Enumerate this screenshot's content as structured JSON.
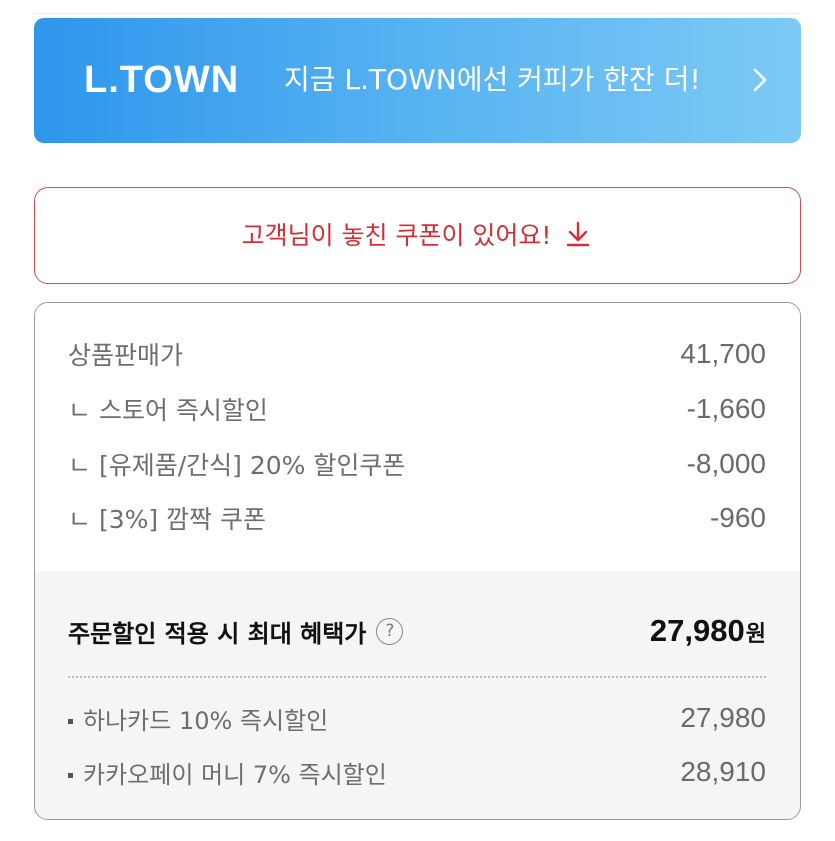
{
  "banner": {
    "logo": "L.TOWN",
    "text": "지금 L.TOWN에선 커피가 한잔 더!",
    "chevron_icon": "chevron-right-icon"
  },
  "coupon_alert": {
    "label": "고객님이 놓친 쿠폰이 있어요!",
    "icon": "download-icon",
    "color": "#d42e37"
  },
  "price_breakdown": {
    "rows": [
      {
        "label": "상품판매가",
        "amount": "41,700"
      },
      {
        "label": "ㄴ 스토어 즉시할인",
        "amount": "-1,660"
      },
      {
        "label": "ㄴ [유제품/간식] 20% 할인쿠폰",
        "amount": "-8,000"
      },
      {
        "label": "ㄴ [3%] 깜짝 쿠폰",
        "amount": "-960"
      }
    ],
    "best_price": {
      "label": "주문할인 적용 시 최대 혜택가",
      "help_icon": "?",
      "amount": "27,980",
      "unit": "원"
    },
    "card_discounts": [
      {
        "label": "하나카드 10% 즉시할인",
        "amount": "27,980"
      },
      {
        "label": "카카오페이 머니 7% 즉시할인",
        "amount": "28,910"
      }
    ]
  },
  "colors": {
    "banner_gradient_start": "#2e96ec",
    "banner_gradient_end": "#7dcaf5",
    "alert_red": "#d42e37"
  }
}
